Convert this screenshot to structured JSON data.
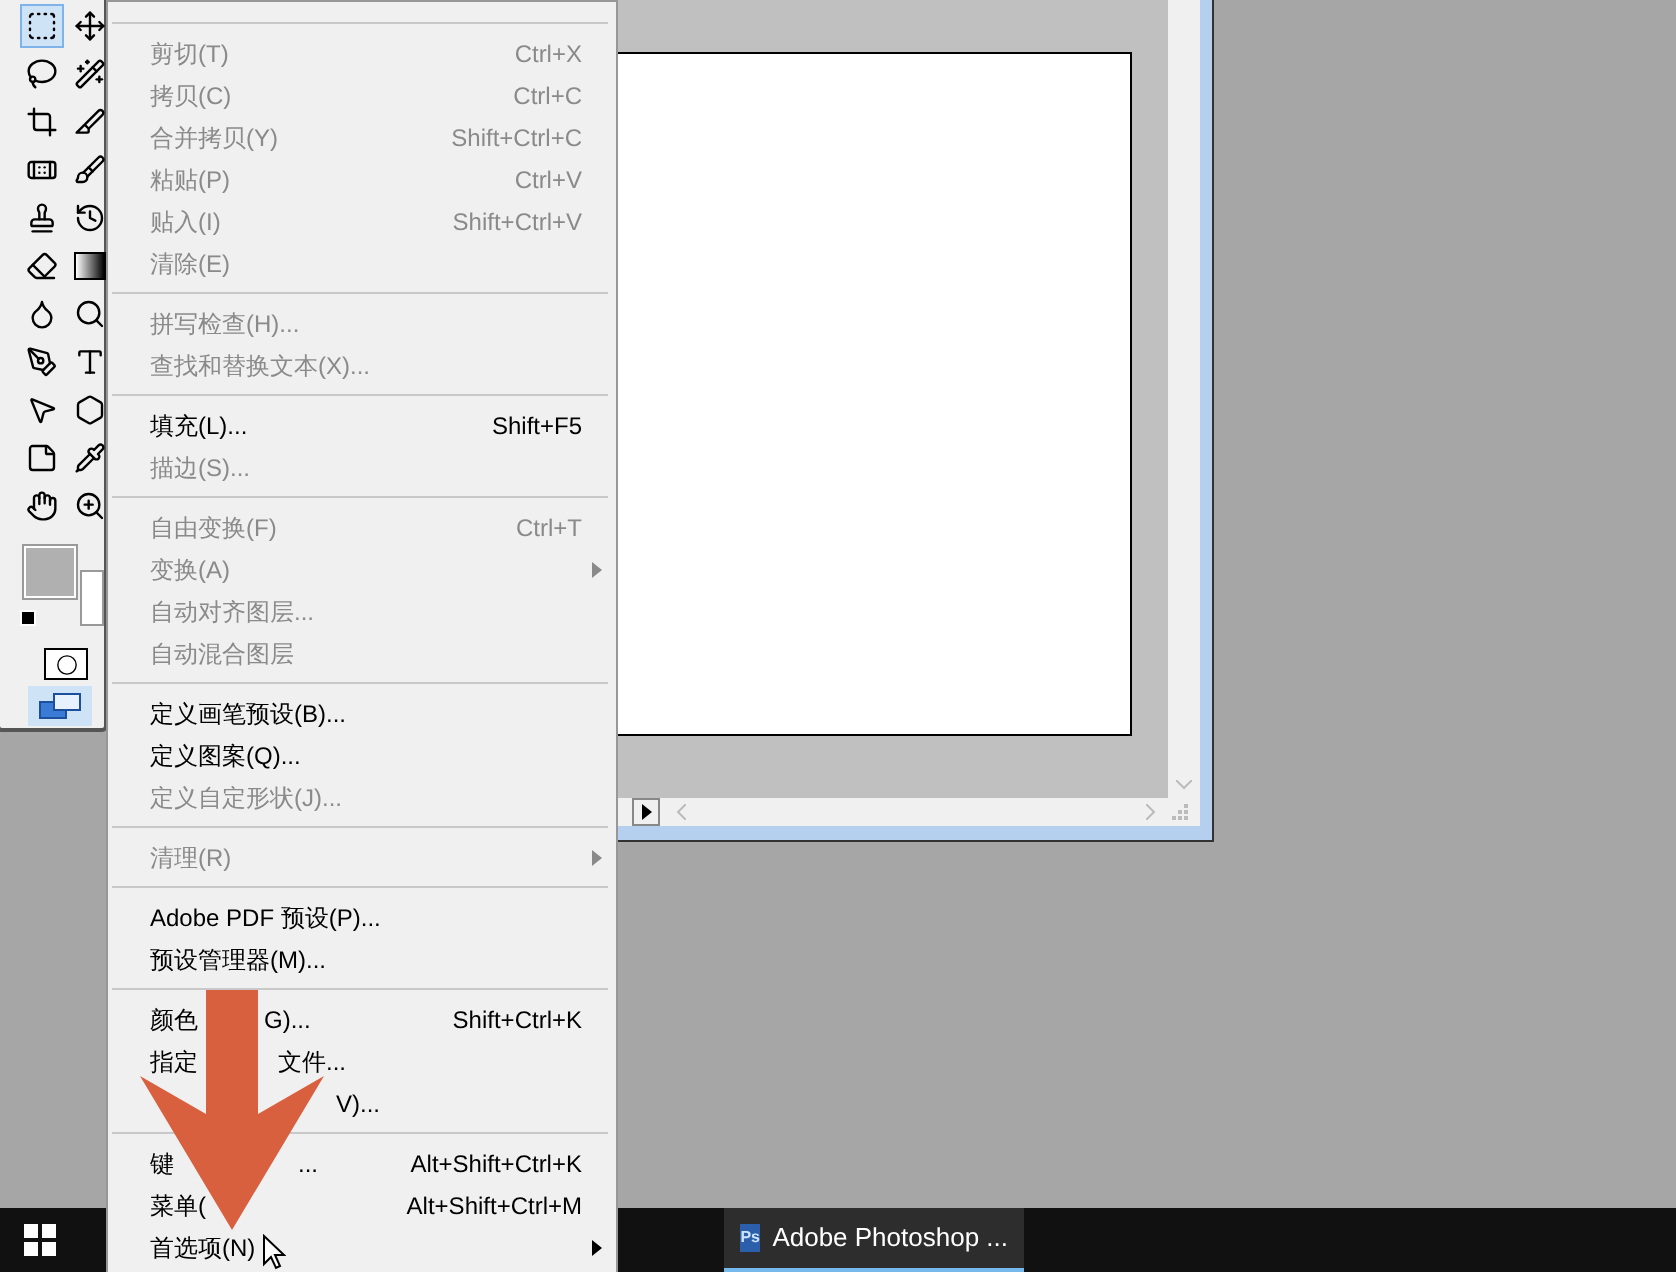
{
  "toolbox": {
    "tools": [
      {
        "kind": "marquee",
        "selected": true
      },
      {
        "kind": "move",
        "selected": false
      },
      {
        "kind": "lasso",
        "selected": false
      },
      {
        "kind": "wand",
        "selected": false
      },
      {
        "kind": "crop",
        "selected": false
      },
      {
        "kind": "slice",
        "selected": false
      },
      {
        "kind": "heal",
        "selected": false
      },
      {
        "kind": "brush",
        "selected": false
      },
      {
        "kind": "stamp",
        "selected": false
      },
      {
        "kind": "history",
        "selected": false
      },
      {
        "kind": "eraser",
        "selected": false
      },
      {
        "kind": "gradient",
        "selected": false
      },
      {
        "kind": "blur",
        "selected": false
      },
      {
        "kind": "dodge",
        "selected": false
      },
      {
        "kind": "pen",
        "selected": false
      },
      {
        "kind": "type",
        "selected": false
      },
      {
        "kind": "select",
        "selected": false
      },
      {
        "kind": "shape",
        "selected": false
      },
      {
        "kind": "notes",
        "selected": false
      },
      {
        "kind": "eyedropper",
        "selected": false
      },
      {
        "kind": "hand",
        "selected": false
      },
      {
        "kind": "zoom",
        "selected": false
      }
    ]
  },
  "menu": {
    "groups": [
      [
        {
          "parts": [
            "剪切(T)"
          ],
          "shortcut": "Ctrl+X",
          "disabled": true
        },
        {
          "parts": [
            "拷贝(C)"
          ],
          "shortcut": "Ctrl+C",
          "disabled": true
        },
        {
          "parts": [
            "合并拷贝(Y)"
          ],
          "shortcut": "Shift+Ctrl+C",
          "disabled": true
        },
        {
          "parts": [
            "粘贴(P)"
          ],
          "shortcut": "Ctrl+V",
          "disabled": true
        },
        {
          "parts": [
            "贴入(I)"
          ],
          "shortcut": "Shift+Ctrl+V",
          "disabled": true
        },
        {
          "parts": [
            "清除(E)"
          ],
          "disabled": true
        }
      ],
      [
        {
          "parts": [
            "拼写检查(H)..."
          ],
          "disabled": true
        },
        {
          "parts": [
            "查找和替换文本(X)..."
          ],
          "disabled": true
        }
      ],
      [
        {
          "parts": [
            "填充(L)..."
          ],
          "shortcut": "Shift+F5",
          "disabled": false
        },
        {
          "parts": [
            "描边(S)..."
          ],
          "disabled": true
        }
      ],
      [
        {
          "parts": [
            "自由变换(F)"
          ],
          "shortcut": "Ctrl+T",
          "disabled": true
        },
        {
          "parts": [
            "变换(A)"
          ],
          "submenu": true,
          "disabled": true
        },
        {
          "parts": [
            "自动对齐图层..."
          ],
          "disabled": true
        },
        {
          "parts": [
            "自动混合图层"
          ],
          "disabled": true
        }
      ],
      [
        {
          "parts": [
            "定义画笔预设(B)..."
          ],
          "disabled": false
        },
        {
          "parts": [
            "定义图案(Q)..."
          ],
          "disabled": false
        },
        {
          "parts": [
            "定义自定形状(J)..."
          ],
          "disabled": true
        }
      ],
      [
        {
          "parts": [
            "清理(R)"
          ],
          "submenu": true,
          "disabled": true
        }
      ],
      [
        {
          "parts": [
            "Adobe PDF 预设(P)..."
          ],
          "disabled": false
        },
        {
          "parts": [
            "预设管理器(M)..."
          ],
          "disabled": false
        }
      ],
      [
        {
          "parts": [
            "颜色",
            "G)..."
          ],
          "shortcut": "Shift+Ctrl+K",
          "disabled": false
        },
        {
          "parts": [
            "指定",
            "文件..."
          ],
          "disabled": false
        },
        {
          "parts": [
            "V)..."
          ],
          "disabled": false
        }
      ],
      [
        {
          "parts": [
            "键",
            "..."
          ],
          "shortcut": "Alt+Shift+Ctrl+K",
          "disabled": false
        },
        {
          "parts": [
            "菜单("
          ],
          "shortcut": "Alt+Shift+Ctrl+M",
          "disabled": false
        },
        {
          "parts": [
            "首选项(N)"
          ],
          "submenu": true,
          "disabled": false
        }
      ]
    ]
  },
  "taskbar": {
    "buttons": [
      {
        "icon_label": "Ps",
        "label": "Adobe Photoshop ...",
        "selected": true
      }
    ]
  }
}
